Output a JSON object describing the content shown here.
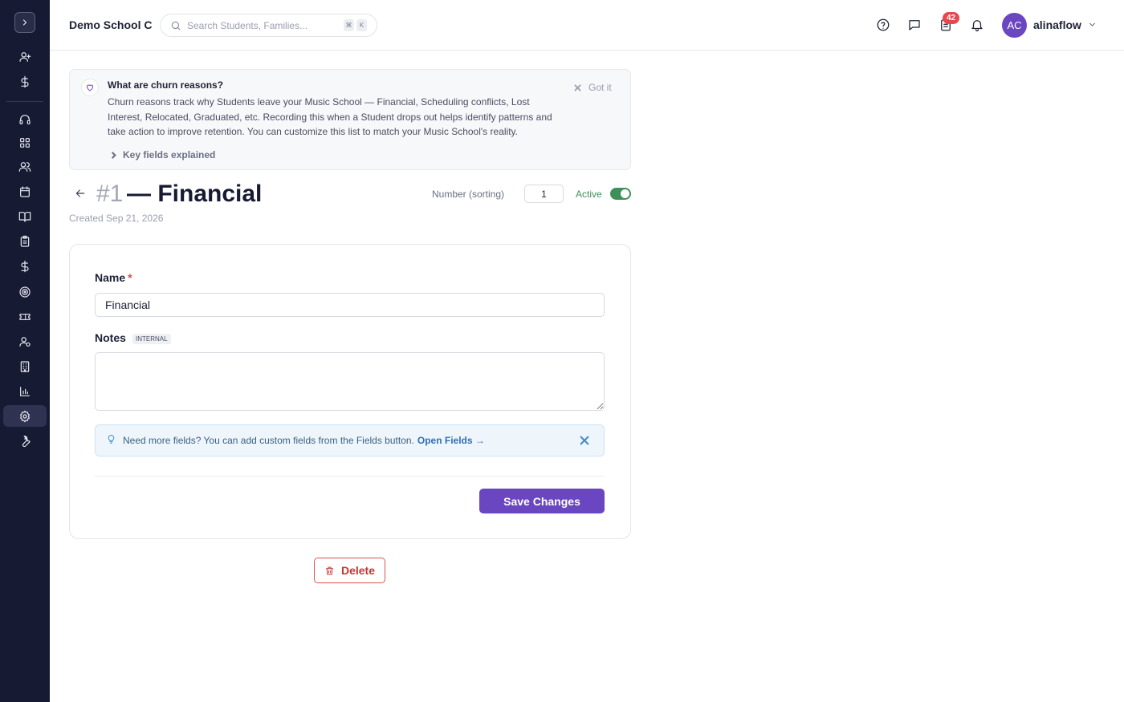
{
  "topbar": {
    "school_name": "Demo School C",
    "search_placeholder": "Search Students, Families...",
    "search_shortcut": [
      "⌘",
      "K"
    ],
    "notification_count": "42",
    "user_initials": "AC",
    "username": "alinaflow"
  },
  "sidebar": {
    "items": [
      "add-user-icon",
      "dollar-icon",
      "headset-icon",
      "dashboard-icon",
      "people-icon",
      "calendar-icon",
      "book-icon",
      "clipboard-icon",
      "dollar-icon",
      "target-icon",
      "ticket-icon",
      "user-settings-icon",
      "building-icon",
      "chart-icon",
      "gear-icon",
      "wrench-icon"
    ],
    "active_item": "gear-icon"
  },
  "info_banner": {
    "title": "What are churn reasons?",
    "body": "Churn reasons track why Students leave your Music School — Financial, Scheduling conflicts, Lost Interest, Relocated, Graduated, etc. Recording this when a Student drops out helps identify patterns and take action to improve retention. You can customize this list to match your Music School's reality.",
    "dismiss_label": "Got it",
    "expander_label": "Key fields explained"
  },
  "record": {
    "number": "#1",
    "title": "— Financial",
    "created": "Created Sep 21, 2026",
    "sorting_label": "Number (sorting)",
    "sorting_value": "1",
    "active_label": "Active",
    "active": true
  },
  "form": {
    "name_label": "Name",
    "required_mark": "*",
    "name_value": "Financial",
    "notes_label": "Notes",
    "notes_tag": "INTERNAL",
    "notes_value": "",
    "hint_text": "Need more fields? You can add custom fields from the Fields button.",
    "hint_link": "Open Fields →",
    "save_label": "Save Changes"
  },
  "delete_label": "Delete",
  "colors": {
    "sidebar_bg": "#171a33",
    "accent": "#6b46c1",
    "active_green": "#3f8f5a",
    "danger": "#c9342f",
    "badge": "#e5484d"
  }
}
